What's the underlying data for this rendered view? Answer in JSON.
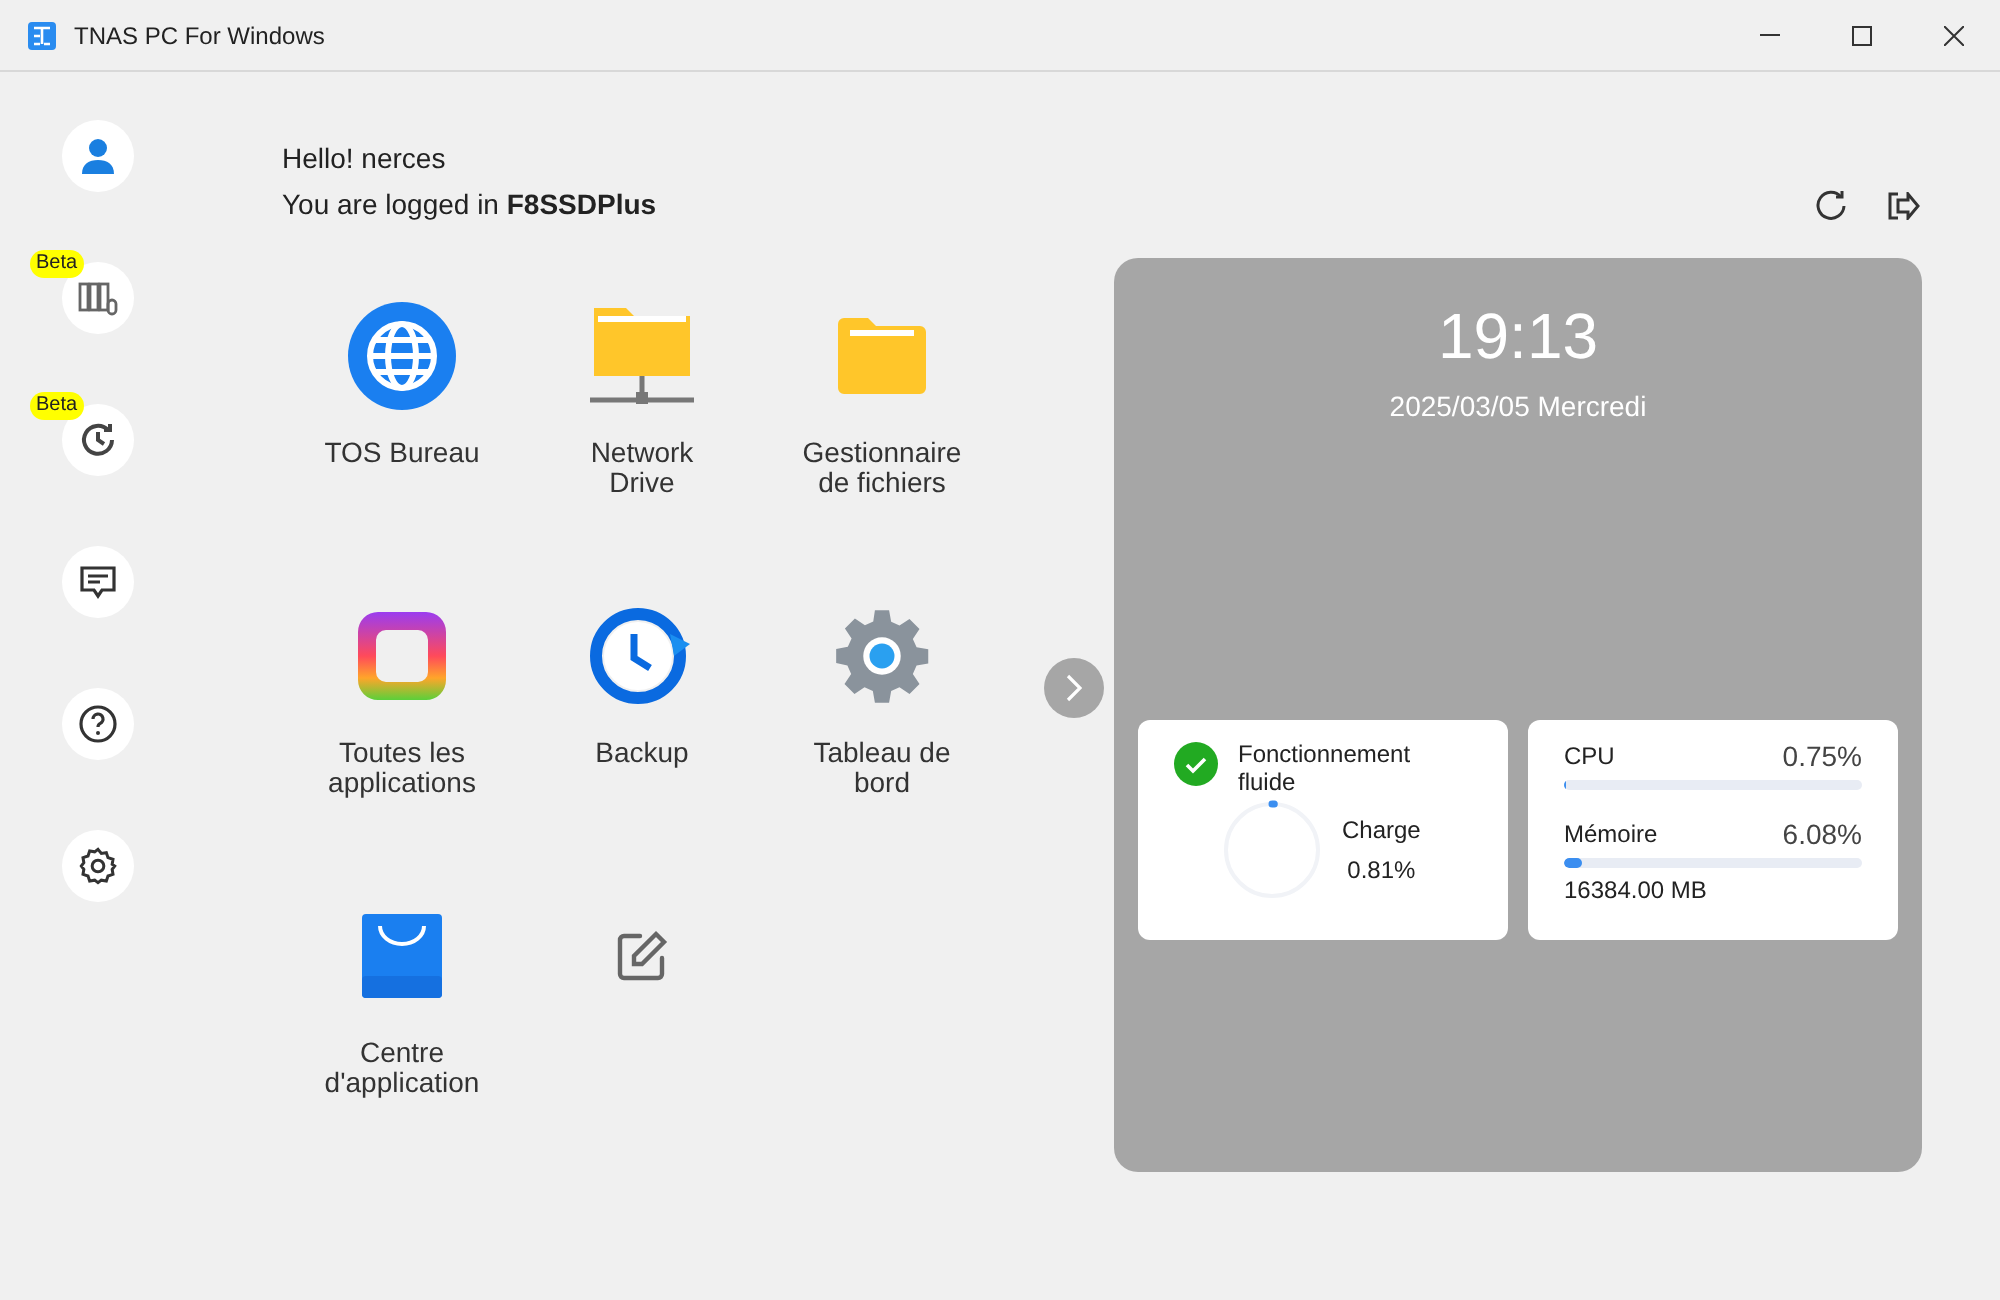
{
  "window": {
    "title": "TNAS PC For Windows"
  },
  "sidebar": {
    "items": [
      {
        "kind": "user"
      },
      {
        "kind": "storage",
        "badge": "Beta"
      },
      {
        "kind": "backup",
        "badge": "Beta"
      },
      {
        "kind": "message"
      },
      {
        "kind": "help"
      },
      {
        "kind": "settings"
      }
    ]
  },
  "greeting": {
    "hello": "Hello! nerces",
    "login_prefix": "You are logged in ",
    "device": "F8SSDPlus"
  },
  "apps": [
    {
      "kind": "globe",
      "label": "TOS Bureau"
    },
    {
      "kind": "network",
      "label": "Network Drive"
    },
    {
      "kind": "folder",
      "label": "Gestionnaire de fichiers"
    },
    {
      "kind": "allapps",
      "label": "Toutes les applications"
    },
    {
      "kind": "backup",
      "label": "Backup"
    },
    {
      "kind": "gear",
      "label": "Tableau de bord"
    },
    {
      "kind": "store",
      "label": "Centre d'application"
    },
    {
      "kind": "edit"
    }
  ],
  "dashboard": {
    "time": "19:13",
    "date": "2025/03/05 Mercredi",
    "status": {
      "text": "Fonctionnement fluide",
      "load_label": "Charge",
      "load_value": "0.81%",
      "level": 0.0081
    },
    "cpu": {
      "label": "CPU",
      "value": "0.75%",
      "level": 0.0075
    },
    "memory": {
      "label": "Mémoire",
      "value": "6.08%",
      "level": 0.0608,
      "total": "16384.00 MB"
    }
  }
}
